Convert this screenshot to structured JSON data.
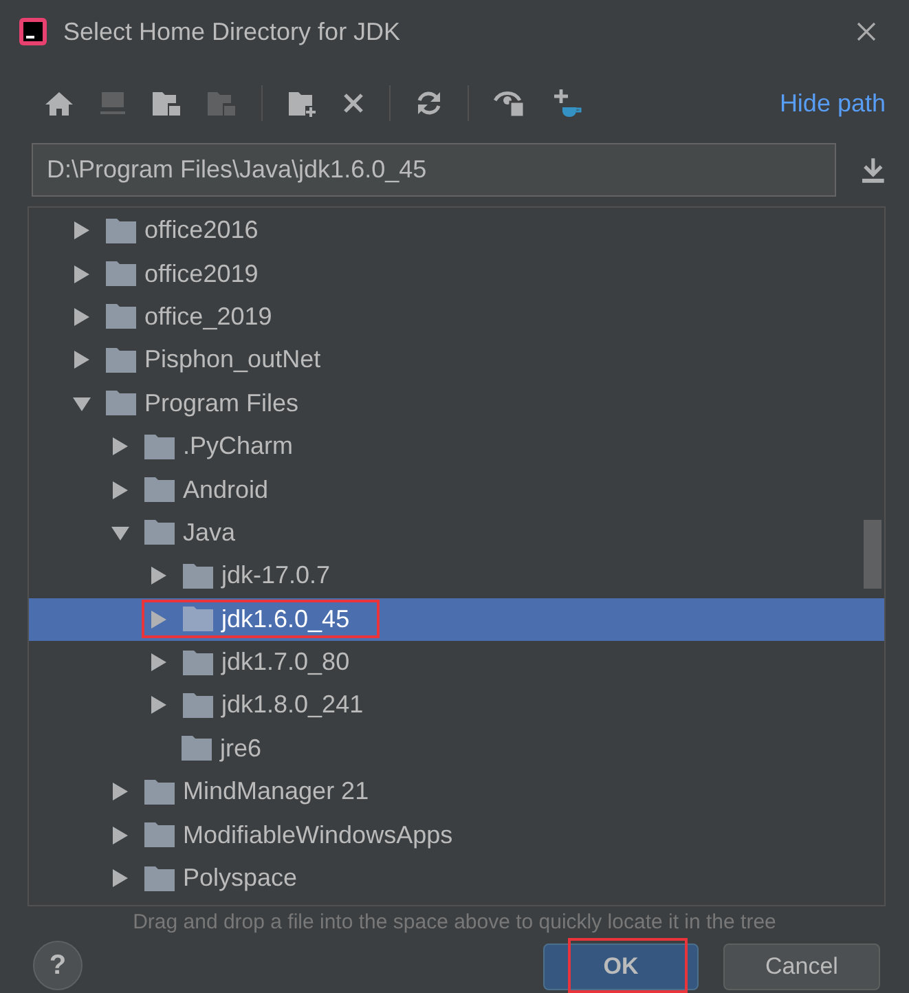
{
  "window": {
    "title": "Select Home Directory for JDK"
  },
  "toolbar": {
    "link": "Hide path"
  },
  "path_field": {
    "value": "D:\\Program Files\\Java\\jdk1.6.0_45"
  },
  "tree": [
    {
      "label": "office2016",
      "expanded": false,
      "selected": false
    },
    {
      "label": "office2019",
      "expanded": false,
      "selected": false
    },
    {
      "label": "office_2019",
      "expanded": false,
      "selected": false
    },
    {
      "label": "Pisphon_outNet",
      "expanded": false,
      "selected": false
    },
    {
      "label": "Program Files",
      "expanded": true,
      "selected": false,
      "children": [
        {
          "label": ".PyCharm",
          "expanded": false,
          "selected": false
        },
        {
          "label": "Android",
          "expanded": false,
          "selected": false
        },
        {
          "label": "Java",
          "expanded": true,
          "selected": false,
          "children": [
            {
              "label": "jdk-17.0.7",
              "expanded": false,
              "selected": false
            },
            {
              "label": "jdk1.6.0_45",
              "expanded": false,
              "selected": true,
              "highlighted": true
            },
            {
              "label": "jdk1.7.0_80",
              "expanded": false,
              "selected": false
            },
            {
              "label": "jdk1.8.0_241",
              "expanded": false,
              "selected": false
            },
            {
              "label": "jre6",
              "leaf": true,
              "selected": false
            }
          ]
        },
        {
          "label": "MindManager 21",
          "expanded": false,
          "selected": false
        },
        {
          "label": "ModifiableWindowsApps",
          "expanded": false,
          "selected": false
        },
        {
          "label": "Polyspace",
          "expanded": false,
          "selected": false
        }
      ]
    }
  ],
  "hint": "Drag and drop a file into the space above to quickly locate it in the tree",
  "buttons": [
    {
      "label": "?",
      "kind": "help"
    },
    {
      "label": "OK",
      "kind": "default",
      "highlighted": true
    },
    {
      "label": "Cancel",
      "kind": "normal"
    }
  ]
}
